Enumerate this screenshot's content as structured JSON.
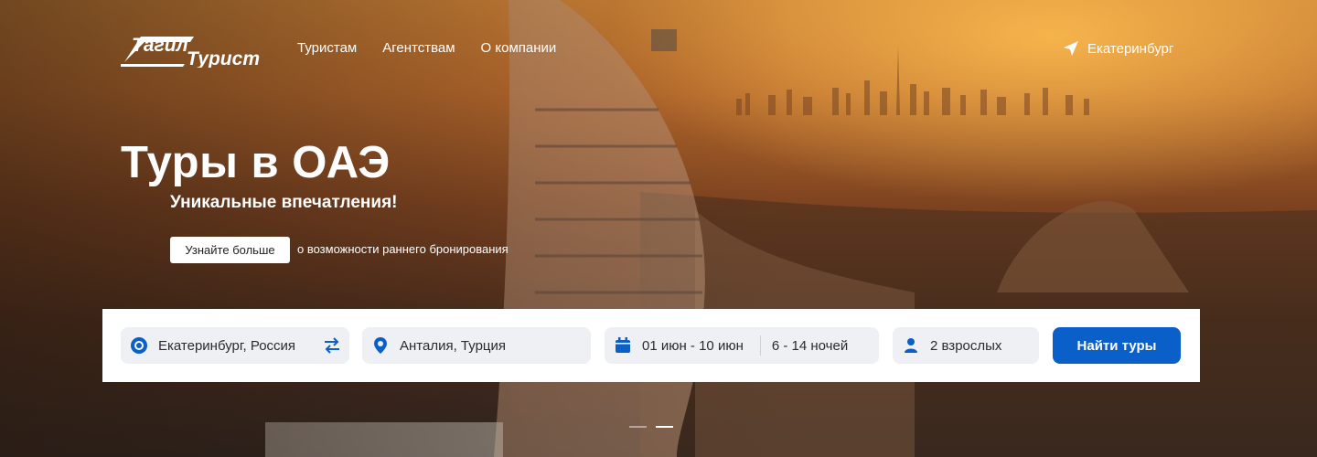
{
  "logo": {
    "text_top": "Тагил",
    "text_bottom": "Турист"
  },
  "nav": {
    "items": [
      "Туристам",
      "Агентствам",
      "О компании"
    ]
  },
  "location": {
    "city": "Екатеринбург",
    "icon": "location-arrow-icon"
  },
  "hero": {
    "title": "Туры в ОАЭ",
    "subtitle": "Уникальные впечатления!",
    "more_button": "Узнайте больше",
    "more_text": "о возможности раннего бронирования"
  },
  "search": {
    "from": "Екатеринбург, Россия",
    "to": "Анталия, Турция",
    "dates": "01 июн - 10 июн",
    "nights": "6 - 14 ночей",
    "guests": "2 взрослых",
    "button": "Найти туры",
    "accent_color": "#0a5fc9"
  },
  "slider": {
    "total": 2,
    "active": 2
  }
}
